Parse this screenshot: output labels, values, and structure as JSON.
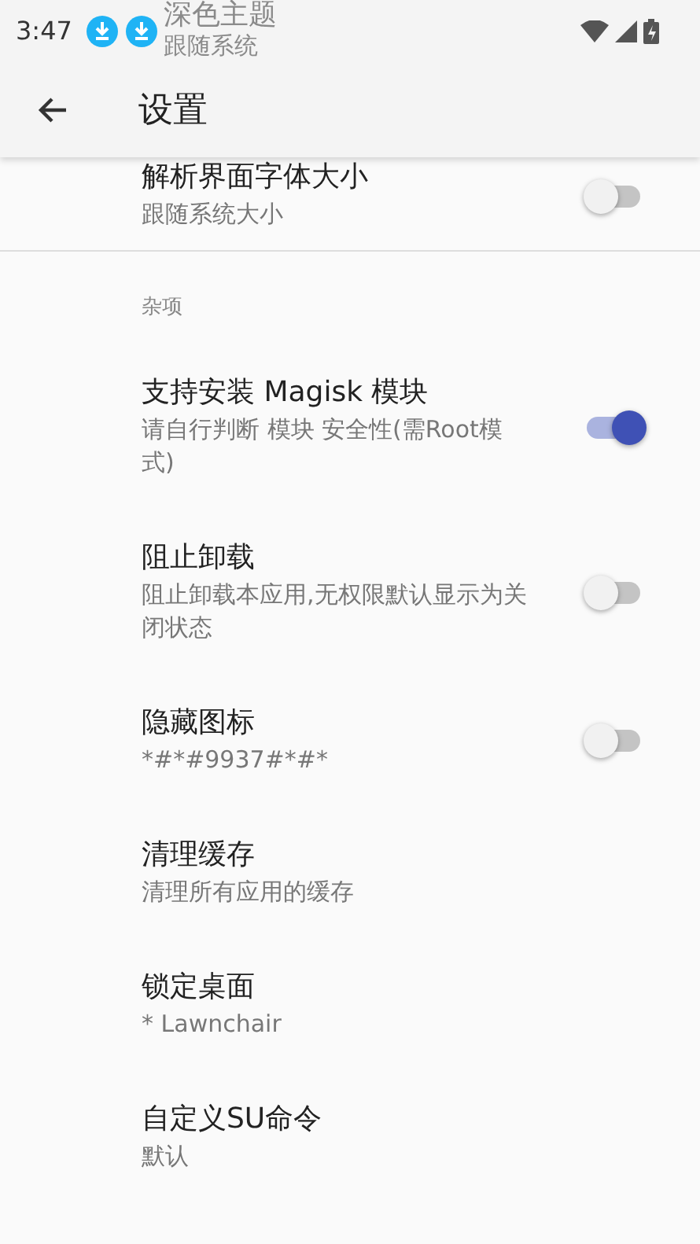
{
  "status_bar": {
    "time": "3:47"
  },
  "background_item": {
    "title": "深色主题",
    "subtitle": "跟随系统"
  },
  "app_bar": {
    "title": "设置"
  },
  "top_items": [
    {
      "kind": "switch",
      "title": "解析界面字体大小",
      "subtitle": "跟随系统大小",
      "on": false
    }
  ],
  "sections": [
    {
      "header": "杂项",
      "items": [
        {
          "kind": "switch",
          "title": "支持安装 Magisk 模块",
          "subtitle": "请自行判断 模块 安全性(需Root模式)",
          "on": true
        },
        {
          "kind": "switch",
          "title": "阻止卸载",
          "subtitle": "阻止卸载本应用,无权限默认显示为关闭状态",
          "on": false
        },
        {
          "kind": "switch",
          "title": "隐藏图标",
          "subtitle": "*#*#9937#*#*",
          "on": false
        },
        {
          "kind": "action",
          "title": "清理缓存",
          "subtitle": "清理所有应用的缓存"
        },
        {
          "kind": "action",
          "title": "锁定桌面",
          "subtitle": "* Lawnchair"
        },
        {
          "kind": "action",
          "title": "自定义SU命令",
          "subtitle": "默认"
        }
      ]
    }
  ]
}
